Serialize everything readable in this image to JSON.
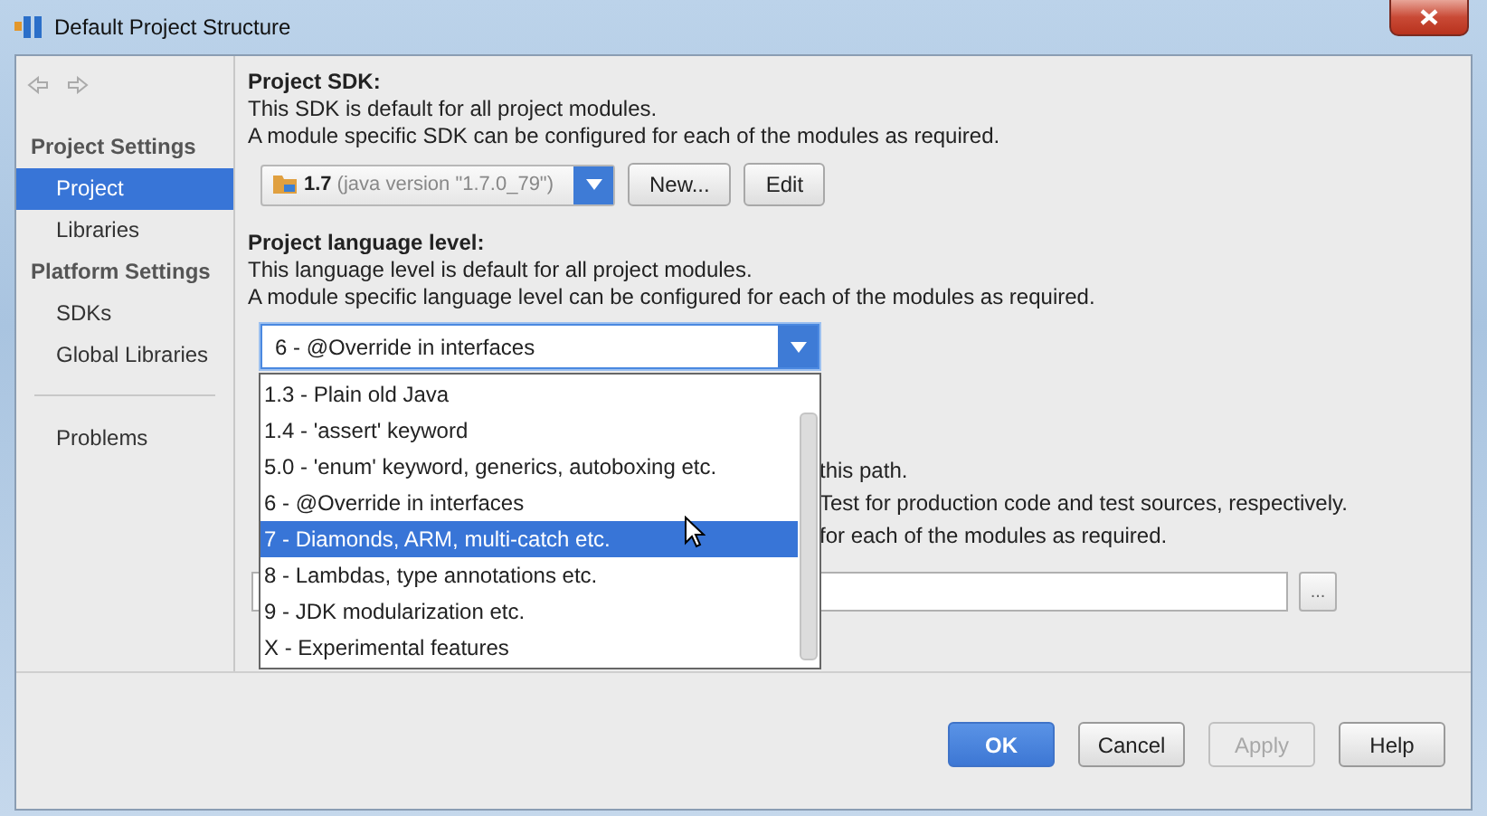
{
  "window": {
    "title": "Default Project Structure"
  },
  "sidebar": {
    "sections": [
      {
        "title": "Project Settings",
        "items": [
          {
            "label": "Project",
            "selected": true
          },
          {
            "label": "Libraries",
            "selected": false
          }
        ]
      },
      {
        "title": "Platform Settings",
        "items": [
          {
            "label": "SDKs",
            "selected": false
          },
          {
            "label": "Global Libraries",
            "selected": false
          }
        ]
      }
    ],
    "extra_items": [
      {
        "label": "Problems",
        "selected": false
      }
    ]
  },
  "project_sdk": {
    "heading": "Project SDK:",
    "lines": [
      "This SDK is default for all project modules.",
      "A module specific SDK can be configured for each of the modules as required."
    ],
    "combo": {
      "version": "1.7",
      "detail": "(java version \"1.7.0_79\")"
    },
    "buttons": [
      "New...",
      "Edit"
    ]
  },
  "language_level": {
    "heading": "Project language level:",
    "lines": [
      "This language level is default for all project modules.",
      "A module specific language level can be configured for each of the modules as required."
    ],
    "combo": {
      "value": "6 - @Override in interfaces",
      "expanded": true
    },
    "options": [
      {
        "label": "1.3 - Plain old Java",
        "selected": false
      },
      {
        "label": "1.4 - 'assert' keyword",
        "selected": false
      },
      {
        "label": "5.0 - 'enum' keyword, generics, autoboxing etc.",
        "selected": false
      },
      {
        "label": "6 - @Override in interfaces",
        "selected": false
      },
      {
        "label": "7 - Diamonds, ARM, multi-catch etc.",
        "selected": true
      },
      {
        "label": "8 - Lambdas, type annotations etc.",
        "selected": false
      },
      {
        "label": "9 - JDK modularization etc.",
        "selected": false
      },
      {
        "label": "X - Experimental features",
        "selected": false
      }
    ]
  },
  "covered_section": {
    "lines": [
      "this path.",
      "Test for production code and test sources, respectively.",
      "for each of the modules as required."
    ],
    "browse_button": "..."
  },
  "footer": {
    "buttons": [
      {
        "label": "OK",
        "kind": "primary",
        "disabled": false
      },
      {
        "label": "Cancel",
        "kind": "normal",
        "disabled": false
      },
      {
        "label": "Apply",
        "kind": "normal",
        "disabled": true
      },
      {
        "label": "Help",
        "kind": "normal",
        "disabled": false
      }
    ]
  }
}
